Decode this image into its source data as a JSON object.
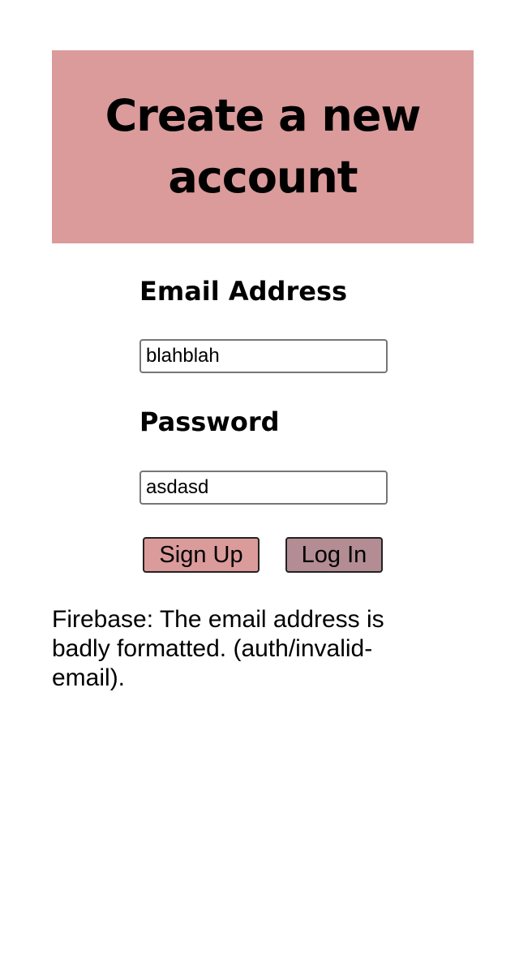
{
  "header": {
    "title": "Create a new account"
  },
  "form": {
    "email_label": "Email Address",
    "email_value": "blahblah",
    "password_label": "Password",
    "password_value": "asdasd",
    "signup_label": "Sign Up",
    "login_label": "Log In"
  },
  "error_message": "Firebase: The email address is badly formatted. (auth/invalid-email).",
  "colors": {
    "header_bg": "#db9b9b",
    "signup_bg": "#db9b9b",
    "login_bg": "#b38c94"
  }
}
